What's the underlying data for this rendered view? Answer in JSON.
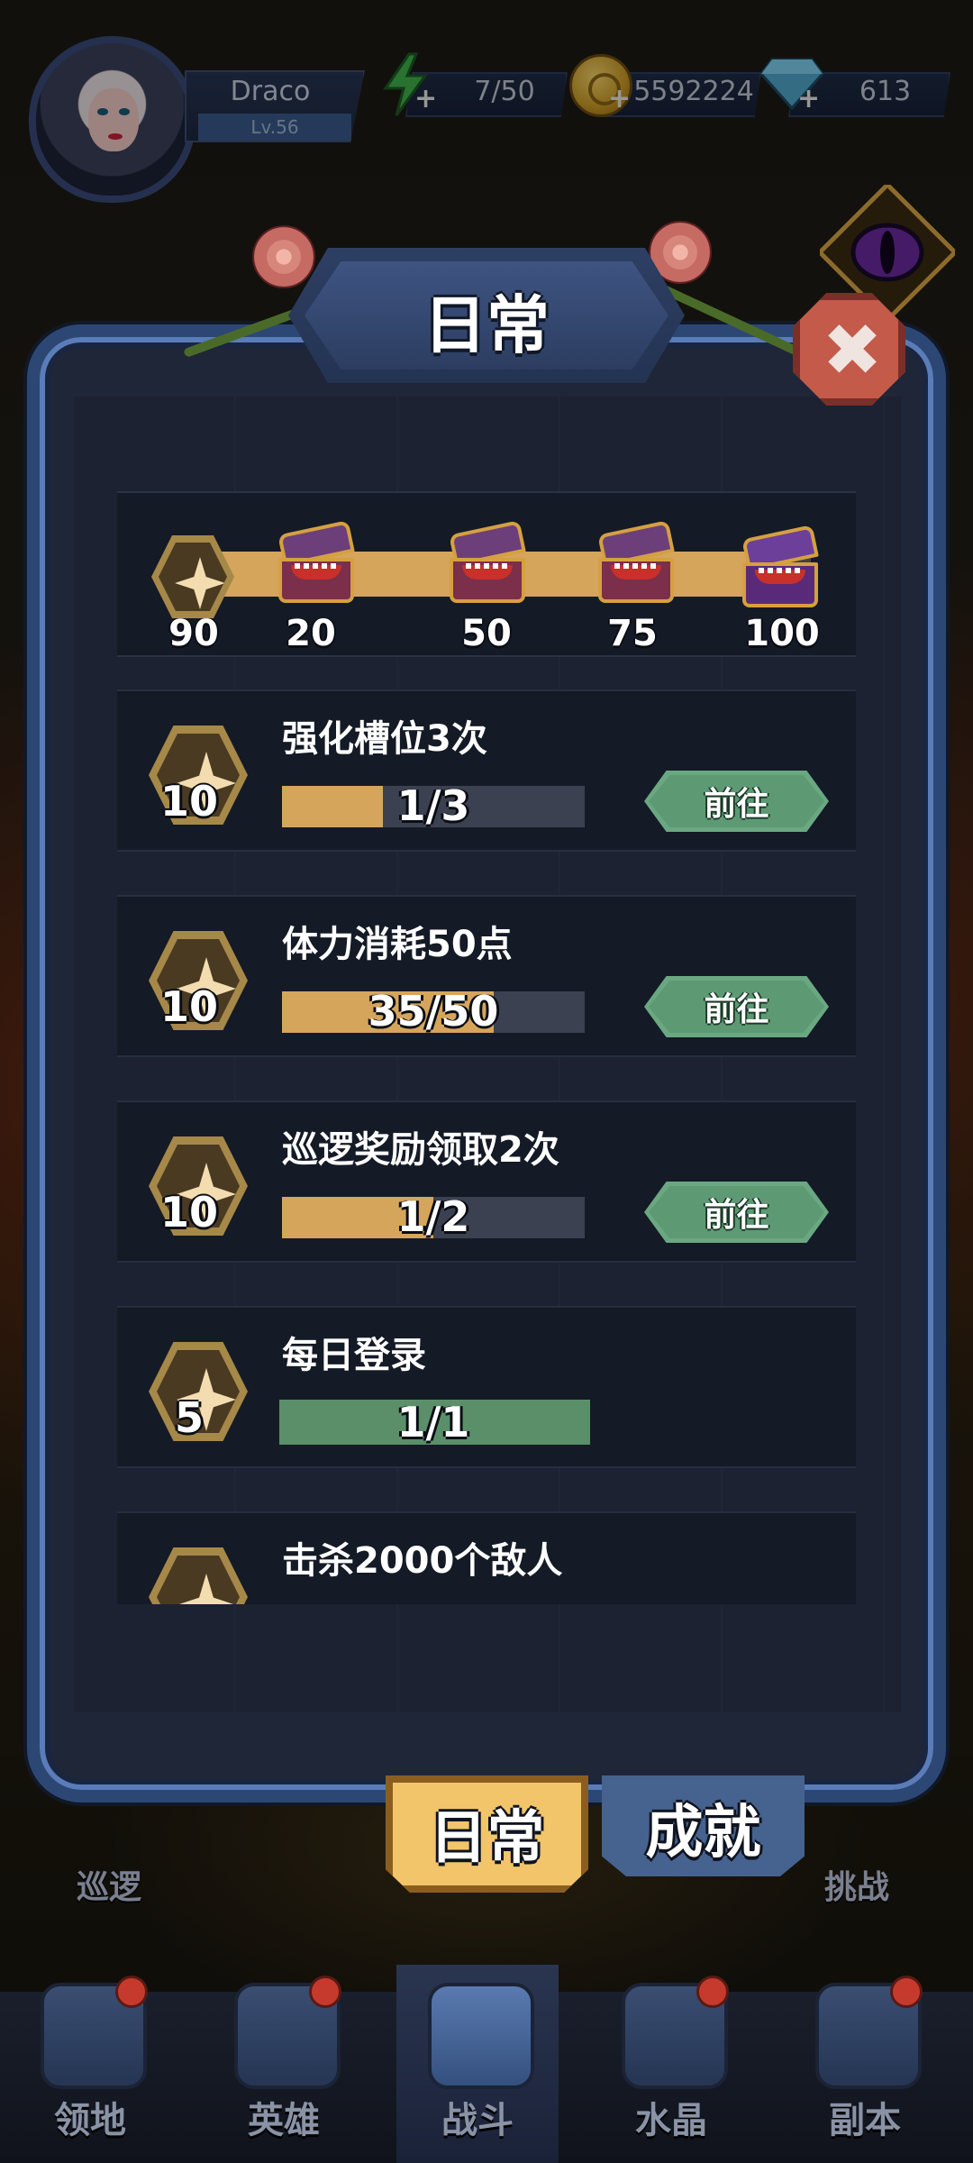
{
  "player": {
    "name": "Draco",
    "level": "Lv.56"
  },
  "resources": {
    "energy": "7/50",
    "gold": "5592224",
    "gems": "613"
  },
  "dialog": {
    "title": "日常",
    "milestones": [
      "20",
      "50",
      "75",
      "100"
    ],
    "current_points": "90",
    "points_progress": 90,
    "points_max": 100
  },
  "tasks": [
    {
      "title": "强化槽位3次",
      "reward": "10",
      "progress": "1/3",
      "fraction": 0.333,
      "button": "前往"
    },
    {
      "title": "体力消耗50点",
      "reward": "10",
      "progress": "35/50",
      "fraction": 0.7,
      "button": "前往"
    },
    {
      "title": "巡逻奖励领取2次",
      "reward": "10",
      "progress": "1/2",
      "fraction": 0.5,
      "button": "前往"
    },
    {
      "title": "每日登录",
      "reward": "5",
      "progress": "1/1",
      "fraction": 1.0
    },
    {
      "title": "击杀2000个敌人"
    }
  ],
  "tabs": {
    "daily": "日常",
    "achievements": "成就"
  },
  "side_labels": {
    "left": "巡逻",
    "right": "挑战"
  },
  "nav": [
    "领地",
    "英雄",
    "战斗",
    "水晶",
    "副本"
  ],
  "colors": {
    "progress_fill": "#d5a55c",
    "complete_fill": "#5a8f6a",
    "go_button": "#6aa882",
    "close_button": "#c45a4a"
  }
}
